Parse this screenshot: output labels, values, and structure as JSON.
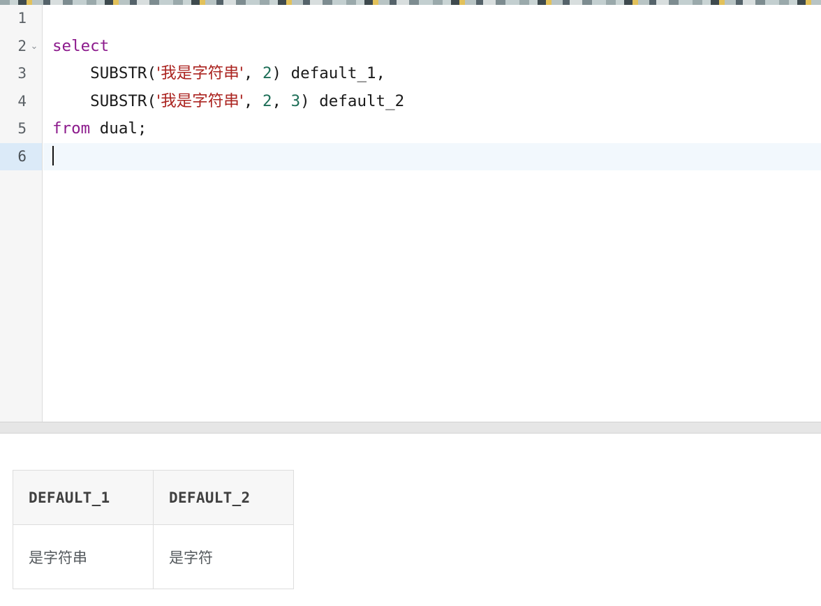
{
  "editor": {
    "gutter": {
      "lines": [
        "1",
        "2",
        "3",
        "4",
        "5",
        "6"
      ],
      "active_line": 6,
      "fold_marker_line": 2,
      "fold_marker_icon": "chevron-down-icon",
      "fold_marker_glyph": "⌄"
    },
    "lines": [
      {
        "number": "1",
        "tokens": []
      },
      {
        "number": "2",
        "tokens": [
          {
            "type": "keyword",
            "text": "select"
          }
        ]
      },
      {
        "number": "3",
        "tokens": [
          {
            "type": "plain",
            "text": "    SUBSTR("
          },
          {
            "type": "string",
            "text": "'我是字符串'"
          },
          {
            "type": "plain",
            "text": ", "
          },
          {
            "type": "number",
            "text": "2"
          },
          {
            "type": "plain",
            "text": ") default_1,"
          }
        ]
      },
      {
        "number": "4",
        "tokens": [
          {
            "type": "plain",
            "text": "    SUBSTR("
          },
          {
            "type": "string",
            "text": "'我是字符串'"
          },
          {
            "type": "plain",
            "text": ", "
          },
          {
            "type": "number",
            "text": "2"
          },
          {
            "type": "plain",
            "text": ", "
          },
          {
            "type": "number",
            "text": "3"
          },
          {
            "type": "plain",
            "text": ") default_2"
          }
        ]
      },
      {
        "number": "5",
        "tokens": [
          {
            "type": "keyword",
            "text": "from"
          },
          {
            "type": "plain",
            "text": " dual;"
          }
        ]
      },
      {
        "number": "6",
        "tokens": [],
        "caret": true
      }
    ],
    "plain_text": "\nselect\n    SUBSTR('我是字符串', 2) default_1,\n    SUBSTR('我是字符串', 2, 3) default_2\nfrom dual;\n"
  },
  "results": {
    "columns": [
      "DEFAULT_1",
      "DEFAULT_2"
    ],
    "rows": [
      [
        "是字符串",
        "是字符"
      ]
    ]
  },
  "colors": {
    "keyword": "#8c1a8c",
    "string": "#ab2420",
    "number": "#1d6e57",
    "plain": "#1a1a1a",
    "gutter_bg": "#f6f6f6",
    "active_line_bg": "#f2f8fd",
    "active_gutter_bg": "#dbeaf8",
    "splitter_bg": "#e6e6e6",
    "table_header_bg": "#f7f7f7",
    "table_border": "#dddddd"
  }
}
